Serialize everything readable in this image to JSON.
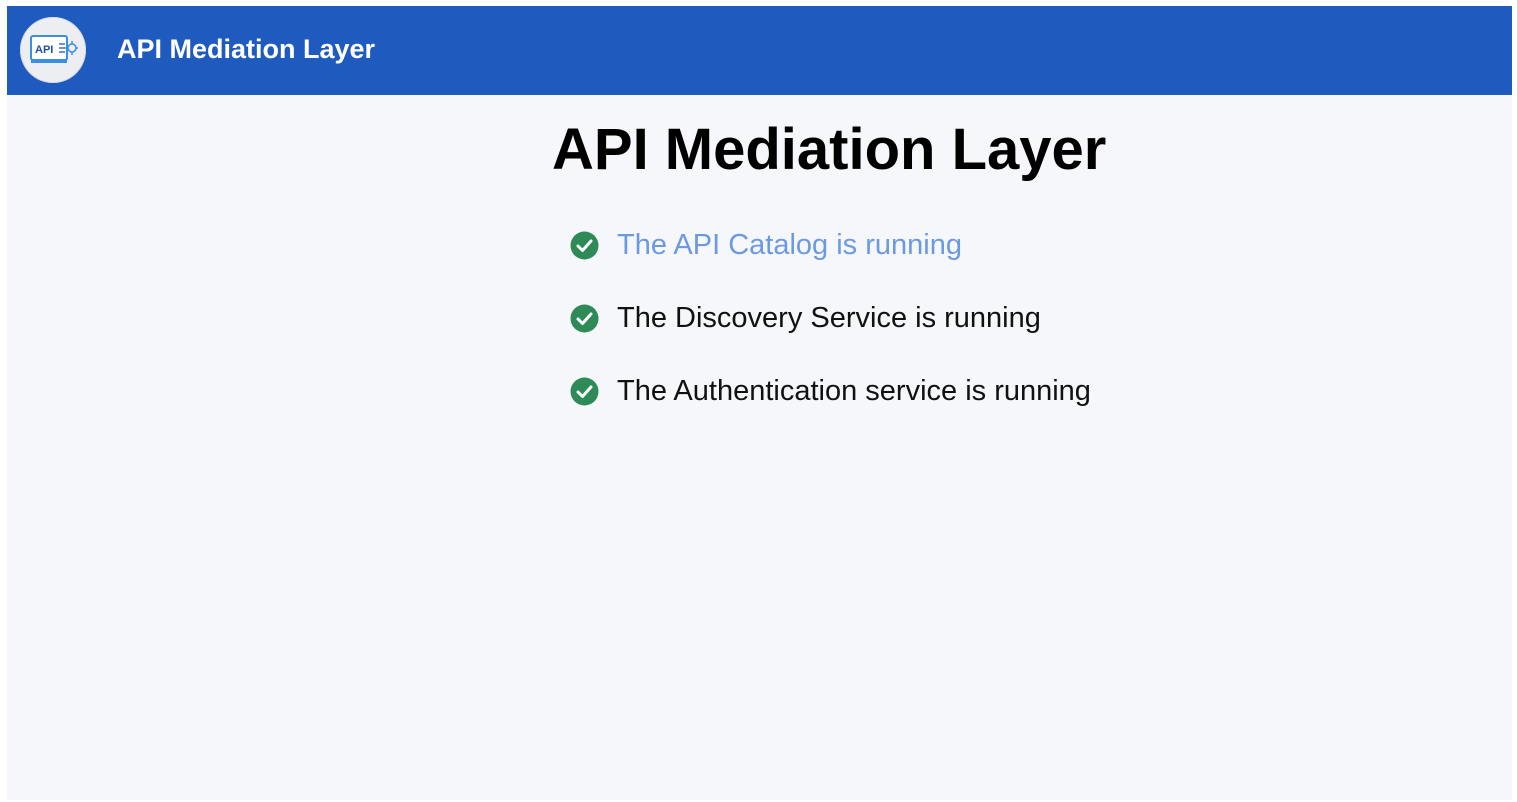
{
  "header": {
    "title": "API Mediation Layer",
    "logo_text": "API",
    "logo_icon": "api-gateway-icon",
    "background_color": "#1f5bbf"
  },
  "main": {
    "title": "API Mediation Layer",
    "statuses": [
      {
        "label": "The API Catalog is running",
        "icon": "check-circle-icon",
        "is_link": true
      },
      {
        "label": "The Discovery Service is running",
        "icon": "check-circle-icon",
        "is_link": false
      },
      {
        "label": "The Authentication service is running",
        "icon": "check-circle-icon",
        "is_link": false
      }
    ]
  },
  "colors": {
    "success": "#2e8a56",
    "link": "#6b9ae3",
    "page_background": "#f5f7fb"
  }
}
